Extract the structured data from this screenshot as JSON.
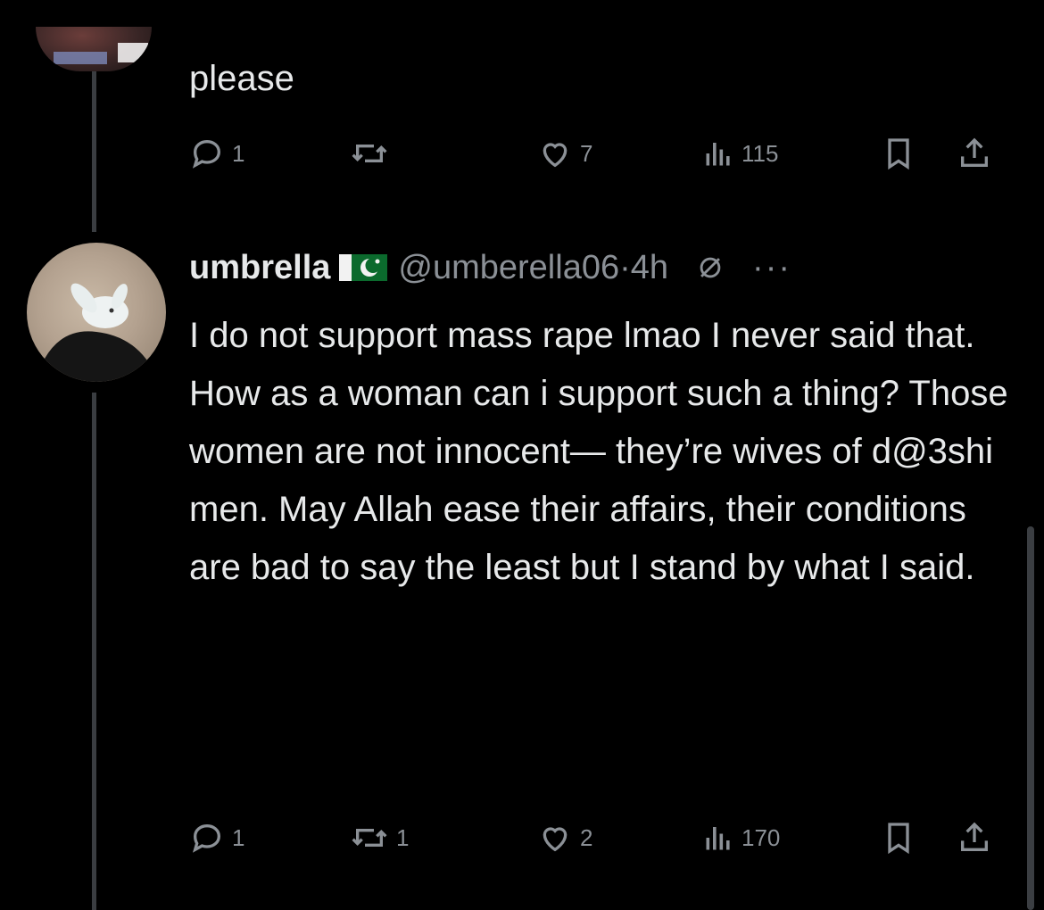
{
  "colors": {
    "background": "#000000",
    "text": "#e7e9ea",
    "muted": "#8b9096",
    "thread": "#3a3d41"
  },
  "previous_post": {
    "text": "please",
    "actions": {
      "replies": "1",
      "reposts": "",
      "likes": "7",
      "views": "115"
    }
  },
  "reply_post": {
    "display_name": "umbrella",
    "flag": "pakistan-flag-icon",
    "handle": "@umberella06",
    "separator": "·",
    "time": "4h",
    "text": "I do not support mass rape lmao I never said that. How as a woman can i support such a thing? Those women are not innocent— they’re wives of d@3shi men. May Allah ease their affairs, their conditions are bad to say the least but I stand by what I said.",
    "actions": {
      "replies": "1",
      "reposts": "1",
      "likes": "2",
      "views": "170"
    }
  }
}
